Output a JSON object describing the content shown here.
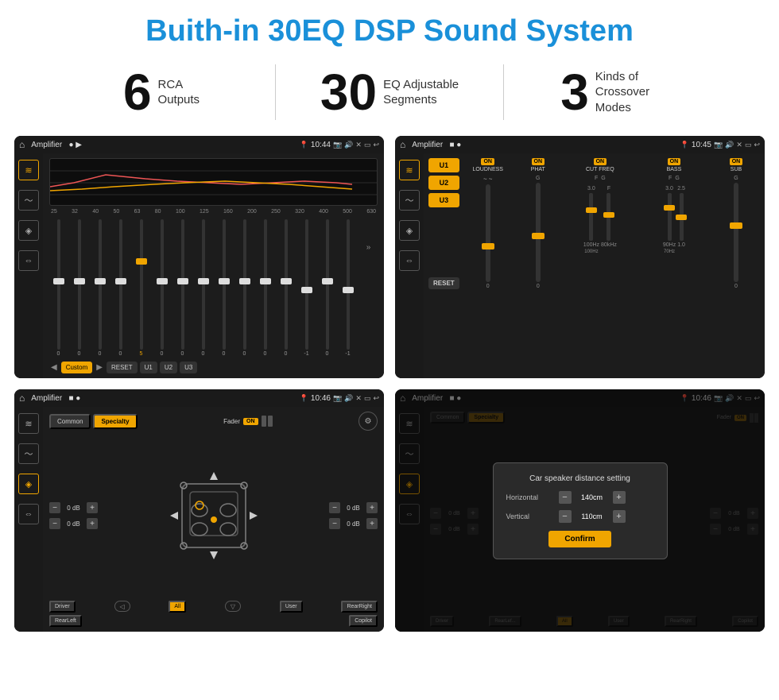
{
  "page": {
    "title": "Buith-in 30EQ DSP Sound System"
  },
  "stats": [
    {
      "number": "6",
      "label": "RCA\nOutputs"
    },
    {
      "number": "30",
      "label": "EQ Adjustable\nSegments"
    },
    {
      "number": "3",
      "label": "Kinds of\nCrossover Modes"
    }
  ],
  "screens": {
    "eq": {
      "title": "Amplifier",
      "time": "10:44",
      "freqs": [
        "25",
        "32",
        "40",
        "50",
        "63",
        "80",
        "100",
        "125",
        "160",
        "200",
        "250",
        "320",
        "400",
        "500",
        "630"
      ],
      "values": [
        "0",
        "0",
        "0",
        "0",
        "5",
        "0",
        "0",
        "0",
        "0",
        "0",
        "0",
        "0",
        "-1",
        "0",
        "-1"
      ],
      "sliderPositions": [
        50,
        50,
        50,
        50,
        35,
        50,
        50,
        50,
        50,
        50,
        50,
        50,
        55,
        50,
        55
      ],
      "presets": [
        "Custom",
        "RESET",
        "U1",
        "U2",
        "U3"
      ]
    },
    "crossover": {
      "title": "Amplifier",
      "time": "10:45",
      "channels": [
        "LOUDNESS",
        "PHAT",
        "CUT FREQ",
        "BASS",
        "SUB"
      ],
      "onStates": [
        true,
        true,
        true,
        true,
        true
      ]
    },
    "fader": {
      "title": "Amplifier",
      "time": "10:46",
      "tabs": [
        "Common",
        "Specialty"
      ],
      "faderLabel": "Fader",
      "onState": true,
      "dbValues": [
        "0 dB",
        "0 dB",
        "0 dB",
        "0 dB"
      ],
      "bottomLabels": [
        "Driver",
        "",
        "All",
        "",
        "User",
        "RearRight",
        "RearLeft",
        "Copilot"
      ]
    },
    "distance": {
      "title": "Amplifier",
      "time": "10:46",
      "tabs": [
        "Common",
        "Specialty"
      ],
      "dialogTitle": "Car speaker distance setting",
      "horizontal": {
        "label": "Horizontal",
        "value": "140cm"
      },
      "vertical": {
        "label": "Vertical",
        "value": "110cm"
      },
      "confirmLabel": "Confirm",
      "bottomLabels": [
        "Driver",
        "RearLef...",
        "All",
        "User",
        "RearRight",
        "Copilot"
      ]
    }
  },
  "icons": {
    "home": "⌂",
    "back": "↩",
    "location": "📍",
    "camera": "📷",
    "volume": "🔊",
    "close": "✕",
    "window": "▭",
    "eq_icon": "≋",
    "wave_icon": "〜",
    "speaker_icon": "◈",
    "arrows_icon": "⇔"
  }
}
